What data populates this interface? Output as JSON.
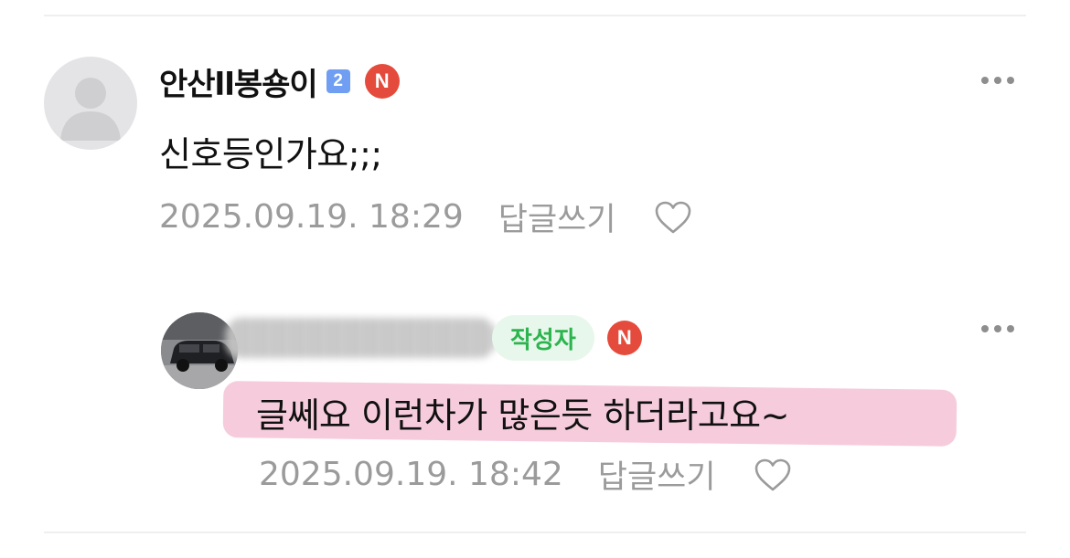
{
  "comments": [
    {
      "author": "안산ll봉숑이",
      "level": "2",
      "n_badge": "N",
      "text": "신호등인가요;;;",
      "timestamp": "2025.09.19. 18:29",
      "reply_label": "답글쓰기"
    },
    {
      "author_badge": "작성자",
      "n_badge": "N",
      "text": "글쎄요 이런차가 많은듯 하더라고요~",
      "timestamp": "2025.09.19. 18:42",
      "reply_label": "답글쓰기"
    }
  ],
  "colors": {
    "accent_red": "#e54b3c",
    "level_blue": "#6f9ef2",
    "author_green": "#2db44e",
    "meta_gray": "#9b9b9b",
    "highlight_pink": "#f4c3d6"
  },
  "icons": {
    "more": "more-horizontal-icon",
    "like": "heart-outline-icon",
    "avatar": "default-user-avatar-icon"
  }
}
